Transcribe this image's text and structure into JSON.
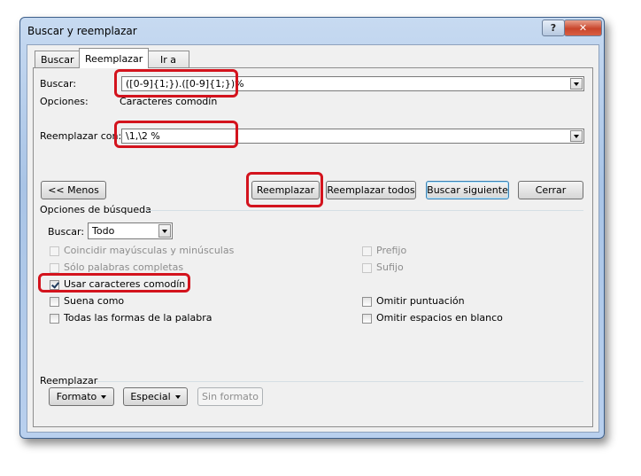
{
  "window": {
    "title": "Buscar y reemplazar",
    "help_label": "?",
    "close_label": "✕"
  },
  "tabs": [
    {
      "label": "Buscar",
      "active": false
    },
    {
      "label": "Reemplazar",
      "active": true
    },
    {
      "label": "Ir a",
      "active": false
    }
  ],
  "find": {
    "label": "Buscar:",
    "value": "([0-9]{1;}).([0-9]{1;})%",
    "options_label": "Opciones:",
    "options_value": "Caracteres comodín"
  },
  "replace": {
    "label": "Reemplazar con:",
    "value": "\\1,\\2 %"
  },
  "buttons": {
    "less": "<< Menos",
    "replace": "Reemplazar",
    "replace_all": "Reemplazar todos",
    "find_next": "Buscar siguiente",
    "close": "Cerrar"
  },
  "search_options": {
    "section_label": "Opciones de búsqueda",
    "search_label": "Buscar:",
    "search_direction": "Todo",
    "left": [
      {
        "label": "Coincidir mayúsculas y minúsculas",
        "checked": false,
        "enabled": false
      },
      {
        "label": "Sólo palabras completas",
        "checked": false,
        "enabled": false
      },
      {
        "label": "Usar caracteres comodín",
        "checked": true,
        "enabled": true
      },
      {
        "label": "Suena como",
        "checked": false,
        "enabled": true
      },
      {
        "label": "Todas las formas de la palabra",
        "checked": false,
        "enabled": true
      }
    ],
    "right": [
      {
        "label": "Prefijo",
        "checked": false,
        "enabled": false
      },
      {
        "label": "Sufijo",
        "checked": false,
        "enabled": false
      },
      {
        "label": "Omitir puntuación",
        "checked": false,
        "enabled": true
      },
      {
        "label": "Omitir espacios en blanco",
        "checked": false,
        "enabled": true
      }
    ]
  },
  "replace_section": {
    "label": "Reemplazar",
    "format_button": "Formato",
    "special_button": "Especial",
    "no_format_button": "Sin formato"
  },
  "colors": {
    "highlight": "#d3131d",
    "window_frame": "#a9c4e6",
    "default_button_border": "#3c7fb1"
  }
}
